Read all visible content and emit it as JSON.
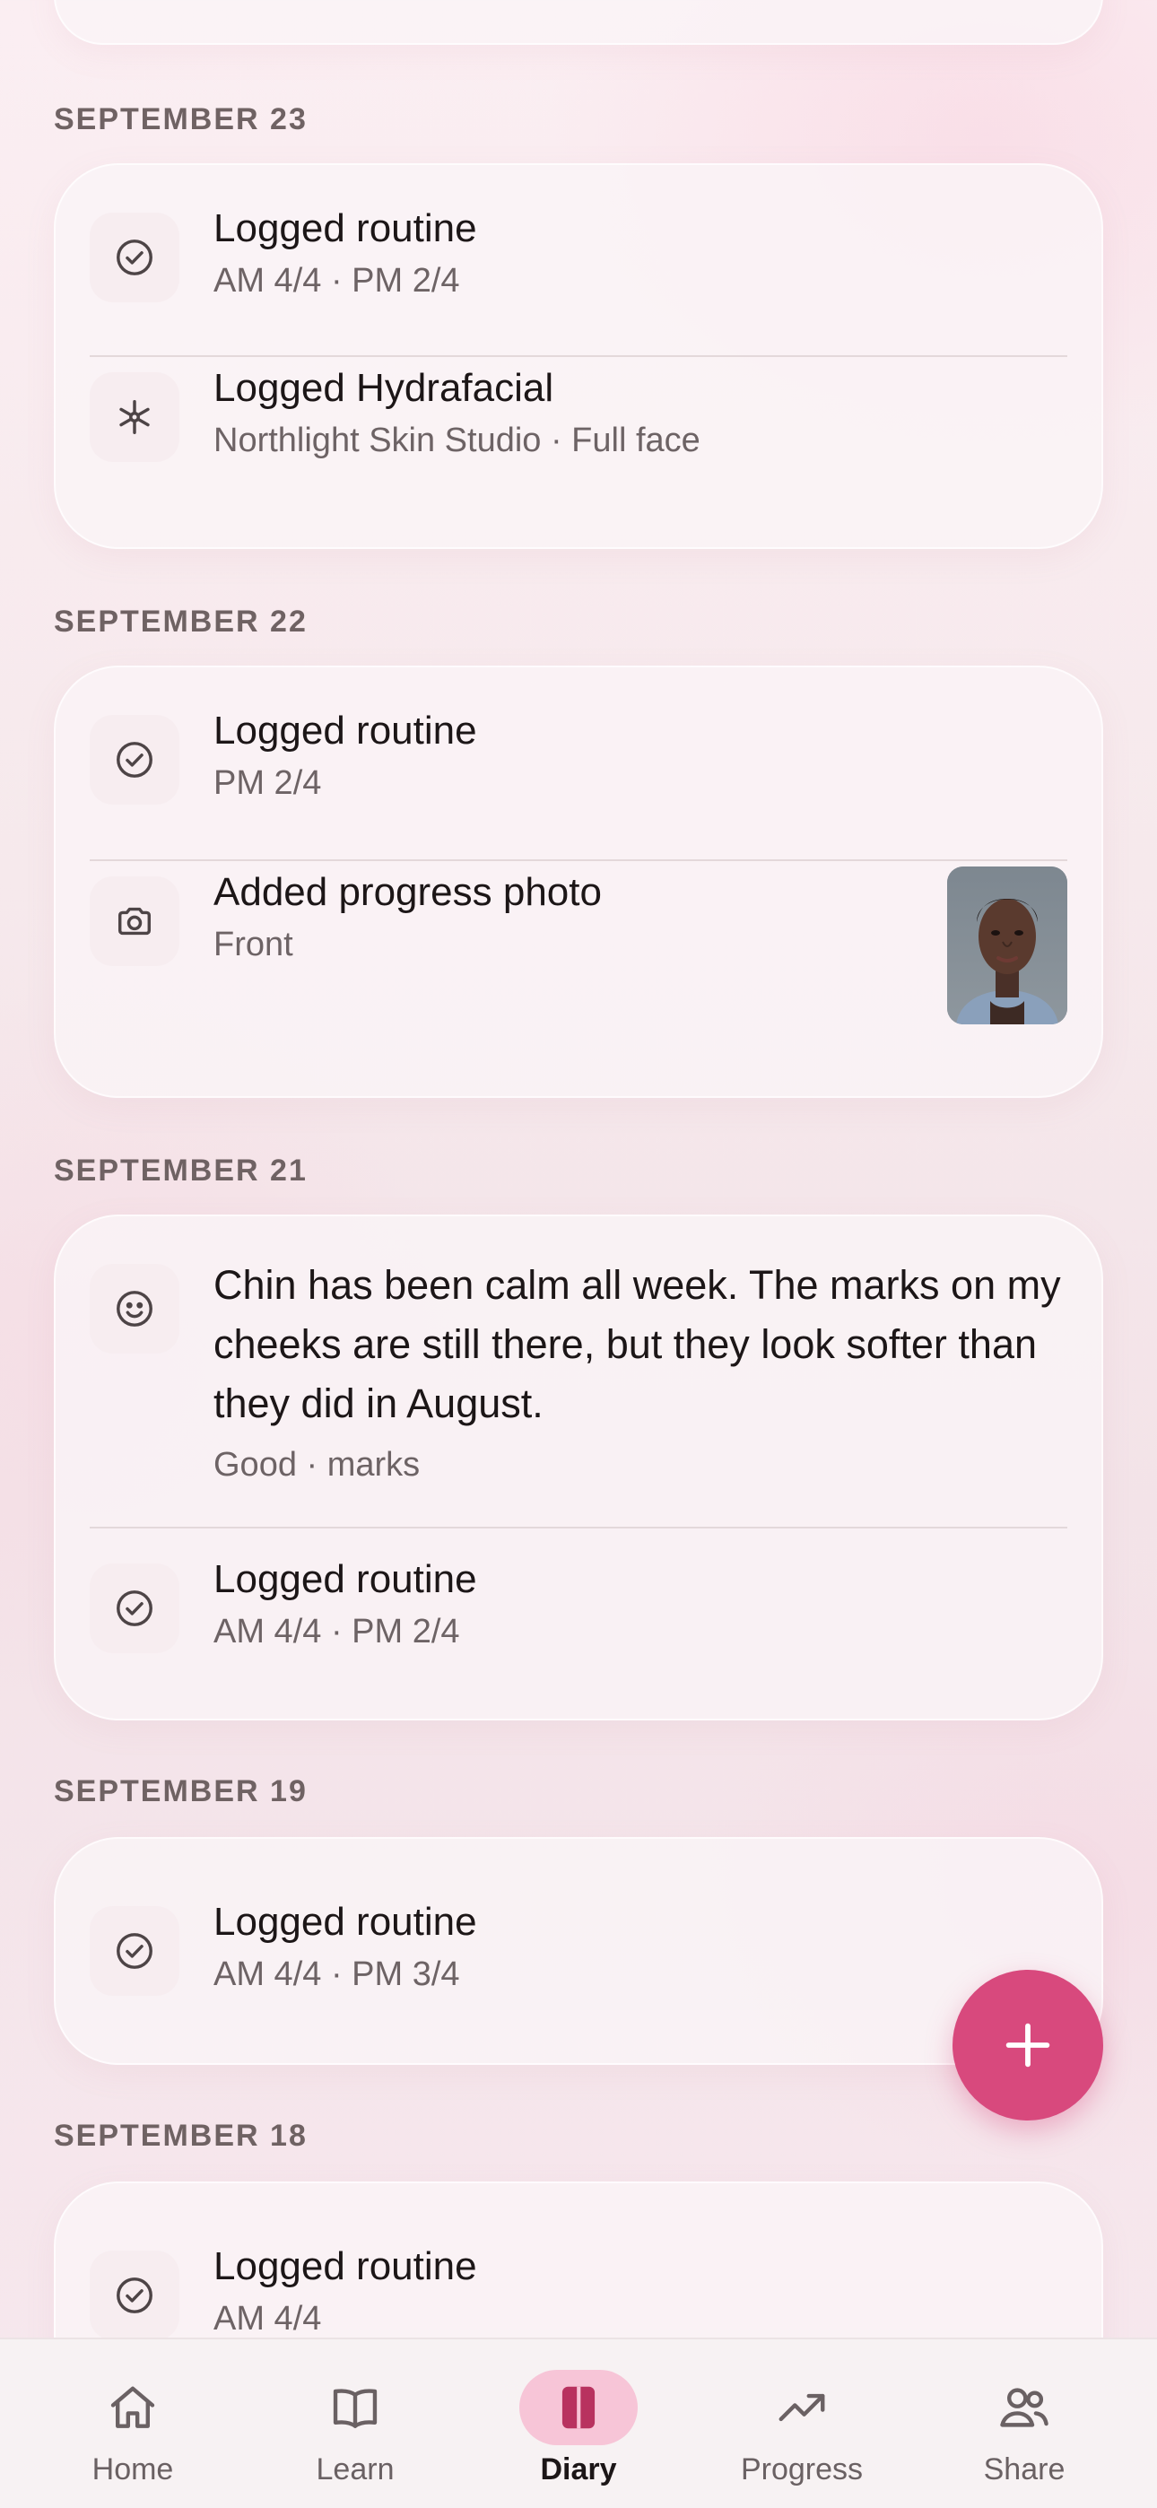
{
  "colors": {
    "accent": "#d8497d",
    "active_tab_bg": "#f7c5d7",
    "text_primary": "#1c1617",
    "text_secondary": "#6d6365"
  },
  "sections": [
    {
      "date": "SEPTEMBER 23",
      "entries": [
        {
          "icon": "check-circle-icon",
          "title": "Logged routine",
          "subtitle": "AM 4/4 · PM 2/4"
        },
        {
          "icon": "sparkle-icon",
          "title": "Logged Hydrafacial",
          "subtitle": "Northlight Skin Studio · Full face"
        }
      ]
    },
    {
      "date": "SEPTEMBER 22",
      "entries": [
        {
          "icon": "check-circle-icon",
          "title": "Logged routine",
          "subtitle": "PM 2/4"
        },
        {
          "icon": "camera-icon",
          "title": "Added progress photo",
          "subtitle": "Front",
          "thumbnail": "progress-photo-thumbnail"
        }
      ]
    },
    {
      "date": "SEPTEMBER 21",
      "entries": [
        {
          "icon": "smile-icon",
          "title": "Chin has been calm all week. The marks on my cheeks are still there, but they look softer than they did in August.",
          "subtitle": "Good · marks"
        },
        {
          "icon": "check-circle-icon",
          "title": "Logged routine",
          "subtitle": "AM 4/4 · PM 2/4"
        }
      ]
    },
    {
      "date": "SEPTEMBER 19",
      "entries": [
        {
          "icon": "check-circle-icon",
          "title": "Logged routine",
          "subtitle": "AM 4/4 · PM 3/4"
        }
      ]
    },
    {
      "date": "SEPTEMBER 18",
      "entries": [
        {
          "icon": "check-circle-icon",
          "title": "Logged routine",
          "subtitle": "AM 4/4"
        }
      ]
    }
  ],
  "fab": {
    "icon": "plus-icon"
  },
  "tabbar": {
    "tabs": [
      {
        "label": "Home",
        "icon": "home-icon",
        "active": false
      },
      {
        "label": "Learn",
        "icon": "book-icon",
        "active": false
      },
      {
        "label": "Diary",
        "icon": "diary-icon",
        "active": true
      },
      {
        "label": "Progress",
        "icon": "trend-icon",
        "active": false
      },
      {
        "label": "Share",
        "icon": "people-icon",
        "active": false
      }
    ]
  }
}
